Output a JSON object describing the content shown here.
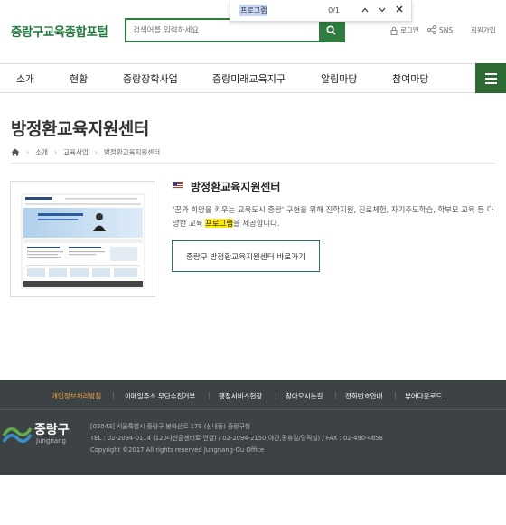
{
  "header": {
    "logo": "중랑구교육종합포털",
    "search_placeholder": "검색어를 입력하세요",
    "login": "로그인",
    "sns": "SNS",
    "join": "회원가입"
  },
  "findbar": {
    "query": "프로그램",
    "count": "0/1"
  },
  "nav": {
    "items": [
      "소개",
      "현황",
      "중랑장학사업",
      "중랑미래교육지구",
      "알림마당",
      "참여마당"
    ]
  },
  "page": {
    "title": "방정환교육지원센터",
    "breadcrumb": [
      "소개",
      "교육사업",
      "방정환교육지원센터"
    ]
  },
  "content": {
    "site_title": "방정환교육지원센터",
    "desc_before": "'꿈과 희망을 키우는 교육도시 중랑' 구현을 위해 진학지원, 진로체험, 자기주도학습, 학부모 교육 등 다양한 교육 ",
    "desc_highlight": "프로그램",
    "desc_after": "을 제공합니다.",
    "button": "중랑구 방정환교육지원센터 바로가기"
  },
  "footer": {
    "links": [
      "개인정보처리방침",
      "이메일주소 무단수집거부",
      "행정서비스헌장",
      "찾아오시는길",
      "전화번호안내",
      "뷰어다운로드"
    ],
    "logo_name": "중랑구",
    "logo_en": "Jungnang",
    "address": "[02043] 서울특별시 중랑구 봉화산로 179 (신내동) 중랑구청",
    "tel": "TEL : 02-2094-0114 (120다산콜센터로 연결) / 02-2094-2150(야간,공휴일/당직실) / FAX : 02-490-4658",
    "copyright": "Copyright ©2017 All rights reserved Jungnang-Gu Office"
  },
  "colors": {
    "brand_green": "#2e7d3e",
    "footer_bg": "#3d4245",
    "privacy_link": "#f0a33a",
    "highlight": "#ffea00"
  }
}
